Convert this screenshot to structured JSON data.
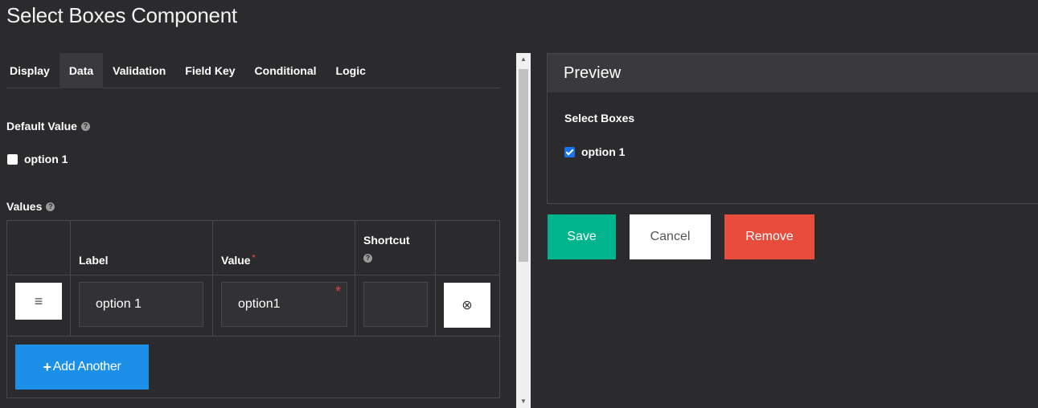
{
  "page_title": "Select Boxes Component",
  "tabs": [
    {
      "label": "Display",
      "active": false
    },
    {
      "label": "Data",
      "active": true
    },
    {
      "label": "Validation",
      "active": false
    },
    {
      "label": "Field Key",
      "active": false
    },
    {
      "label": "Conditional",
      "active": false
    },
    {
      "label": "Logic",
      "active": false
    }
  ],
  "default_value": {
    "label": "Default Value",
    "help_icon": "question-circle-icon",
    "options": [
      {
        "label": "option 1",
        "checked": false
      }
    ]
  },
  "values": {
    "label": "Values",
    "help_icon": "question-circle-icon",
    "columns": {
      "label": "Label",
      "value": "Value",
      "value_required": "*",
      "shortcut": "Shortcut"
    },
    "rows": [
      {
        "label": "option 1",
        "value": "option1",
        "value_required_marker": "*",
        "shortcut": ""
      }
    ],
    "drag_icon": "≡",
    "remove_icon": "⊗",
    "add_button": {
      "icon": "+",
      "label": "Add Another"
    }
  },
  "preview": {
    "heading": "Preview",
    "field_label": "Select Boxes",
    "options": [
      {
        "label": "option 1",
        "checked": true
      }
    ]
  },
  "actions": {
    "save": "Save",
    "cancel": "Cancel",
    "remove": "Remove"
  },
  "colors": {
    "background": "#2b2b2d",
    "save": "#00b48e",
    "remove": "#e74c3c",
    "add": "#1c8fe8"
  }
}
